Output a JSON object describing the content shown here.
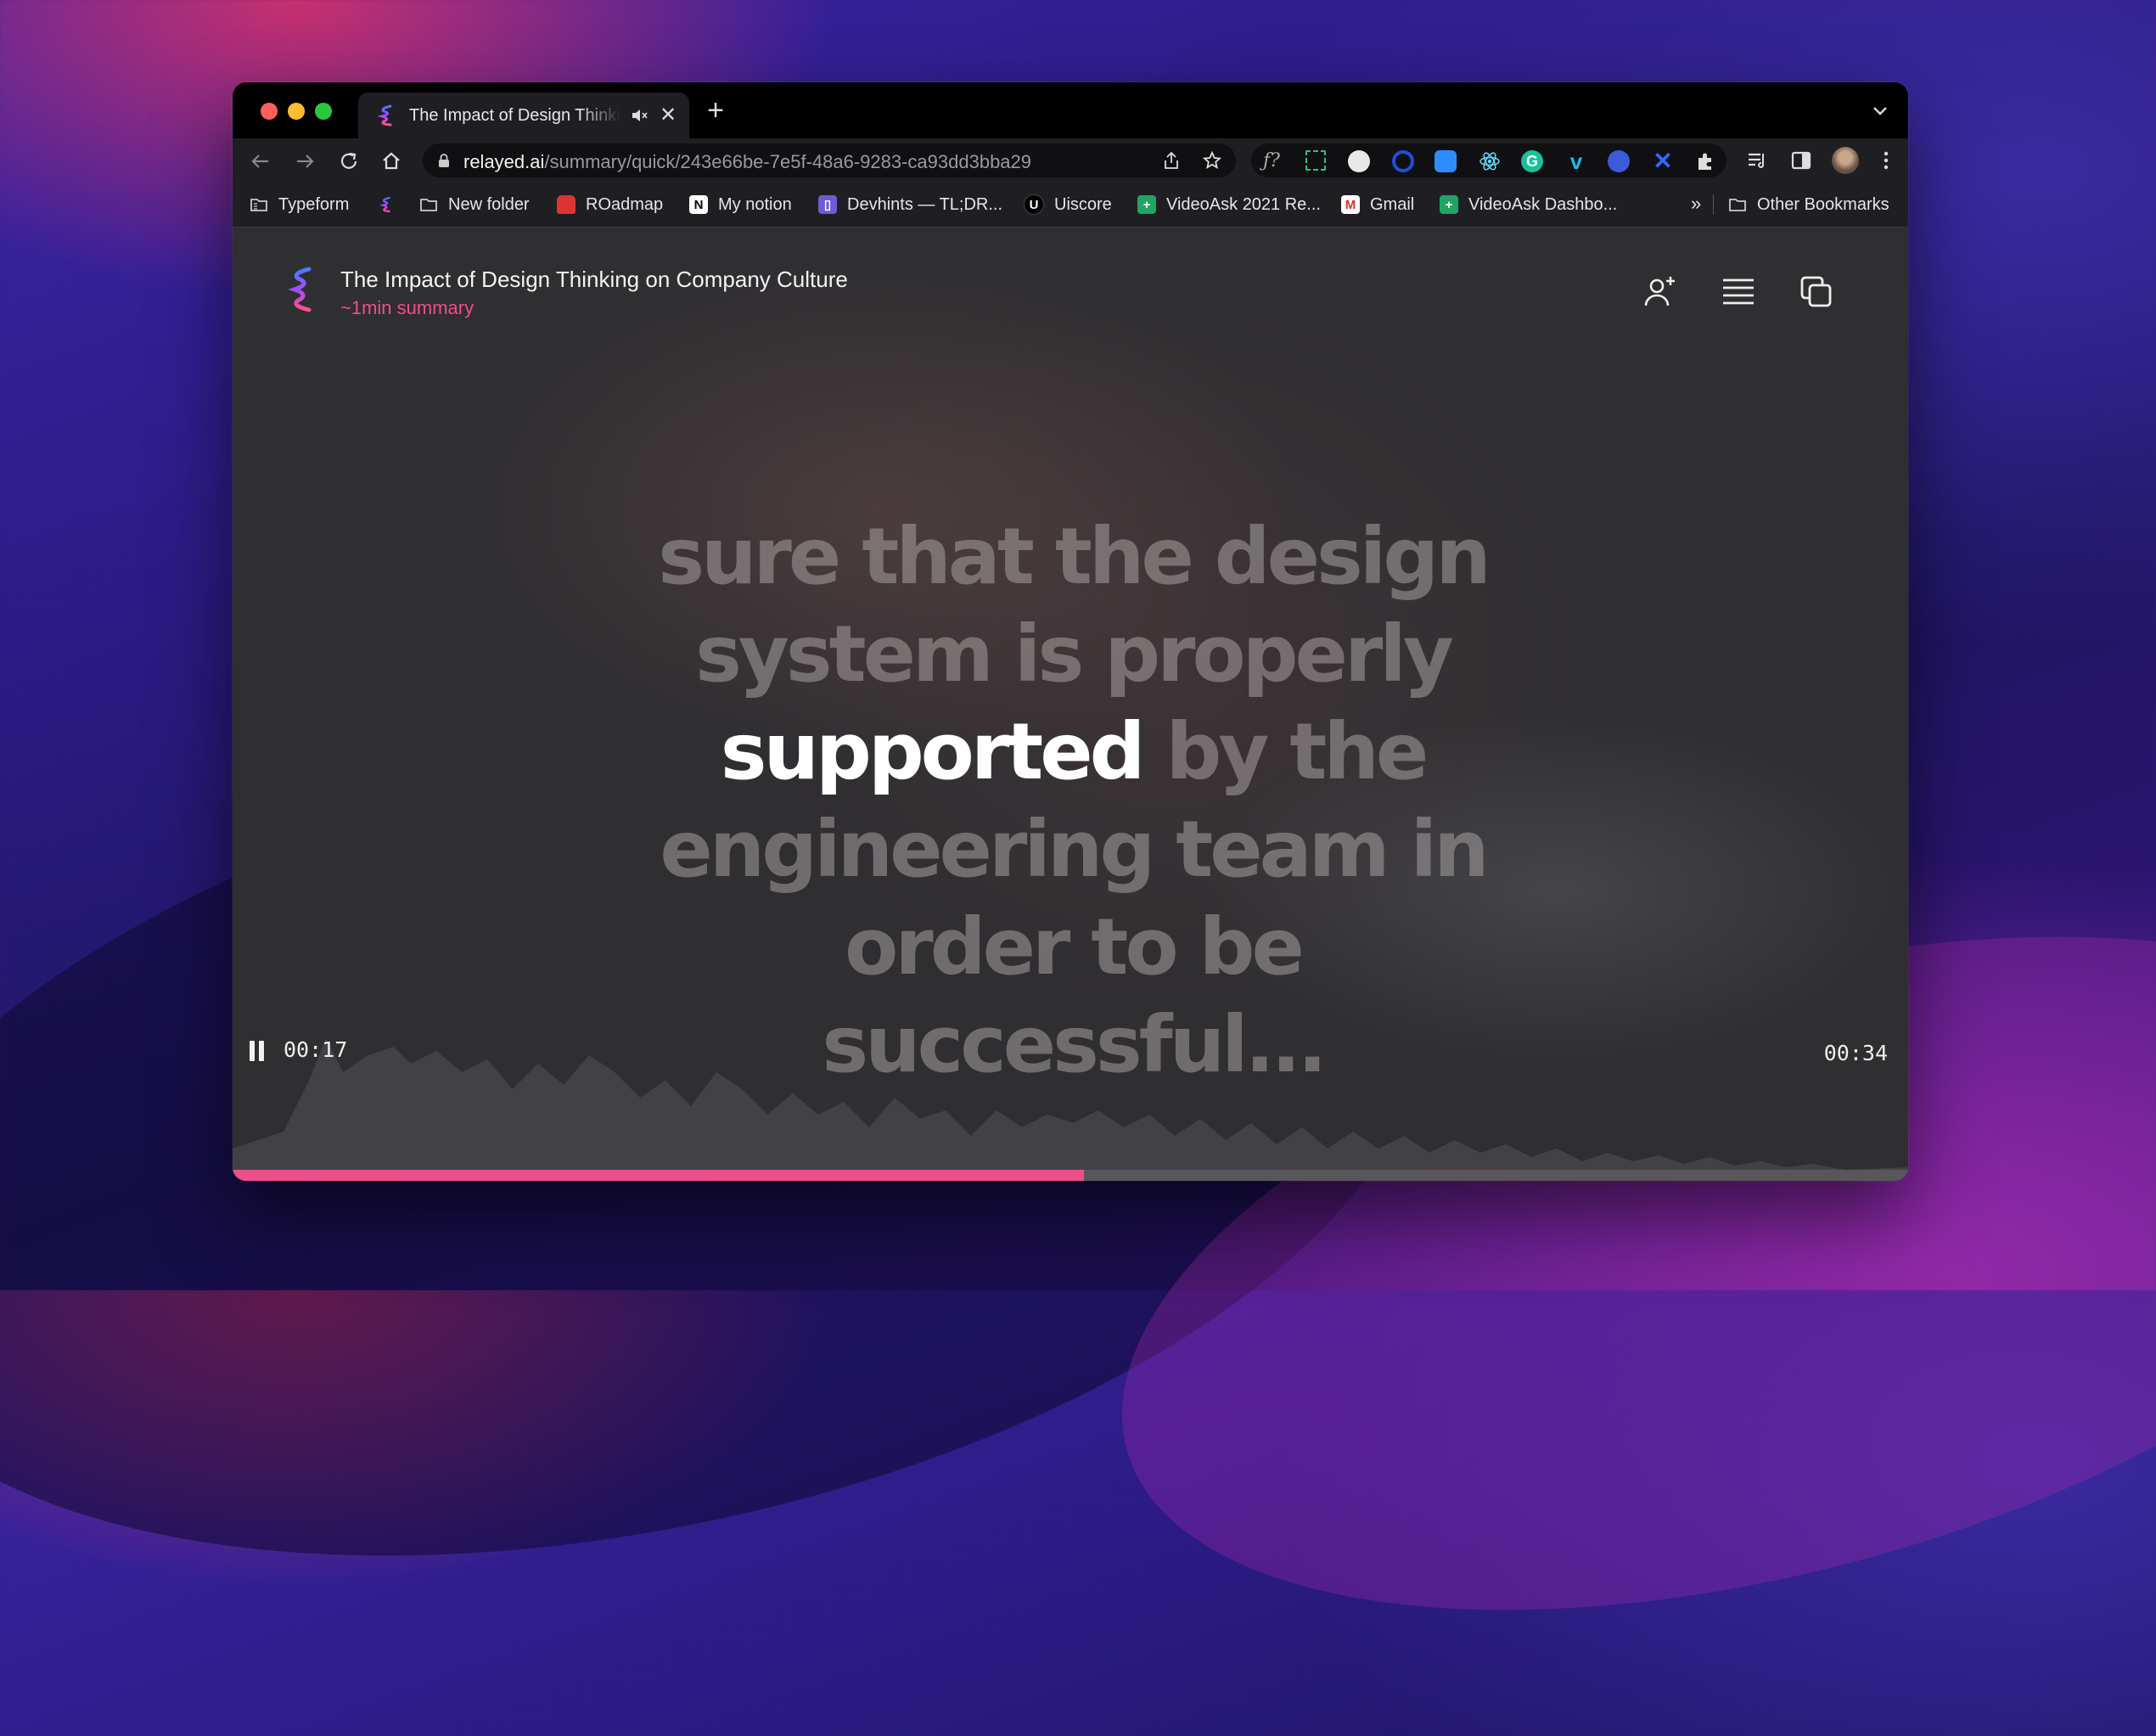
{
  "browser": {
    "tab": {
      "title": "The Impact of Design Thinking on Company Culture",
      "close_symbol": "✕"
    },
    "new_tab_symbol": "+",
    "omnibox": {
      "url_host": "relayed.ai",
      "url_path": "/summary/quick/243e66be-7e5f-48a6-9283-ca93dd3bba29"
    },
    "extensions": [
      "formula-ext-icon",
      "screenshot-ext-icon",
      "password-ext-icon",
      "circle-ext-icon",
      "zoom-ext-icon",
      "react-devtools-icon",
      "grammarly-icon",
      "vimeo-icon",
      "blue-circle-ext-icon",
      "cross-ext-icon",
      "puzzle-icon"
    ],
    "bookmarks": [
      {
        "label": "Typeform",
        "icon": "folder-icon"
      },
      {
        "label": "",
        "icon": "relayed-icon"
      },
      {
        "label": "New folder",
        "icon": "folder-icon"
      },
      {
        "label": "ROadmap",
        "icon": "car-icon"
      },
      {
        "label": "My notion",
        "icon": "notion-icon"
      },
      {
        "label": "Devhints — TL;DR...",
        "icon": "devhints-icon"
      },
      {
        "label": "Uiscore",
        "icon": "uiscore-icon"
      },
      {
        "label": "VideoAsk 2021 Re...",
        "icon": "sheets-icon"
      },
      {
        "label": "Gmail",
        "icon": "gmail-icon"
      },
      {
        "label": "VideoAsk Dashbo...",
        "icon": "sheets-icon"
      }
    ],
    "bookmarks_more": "»",
    "other_bookmarks": "Other Bookmarks"
  },
  "player": {
    "title": "The Impact of Design Thinking on Company Culture",
    "subtitle": "~1min summary",
    "transcript": {
      "before": "sure that the design system is properly ",
      "highlight": "supported",
      "after": " by the engineering team in order to be successful..."
    },
    "current_time": "00:17",
    "total_time": "00:34",
    "progress": 0.508,
    "colors": {
      "accent": "#ec4f8a",
      "background": "#2f2e31"
    }
  }
}
